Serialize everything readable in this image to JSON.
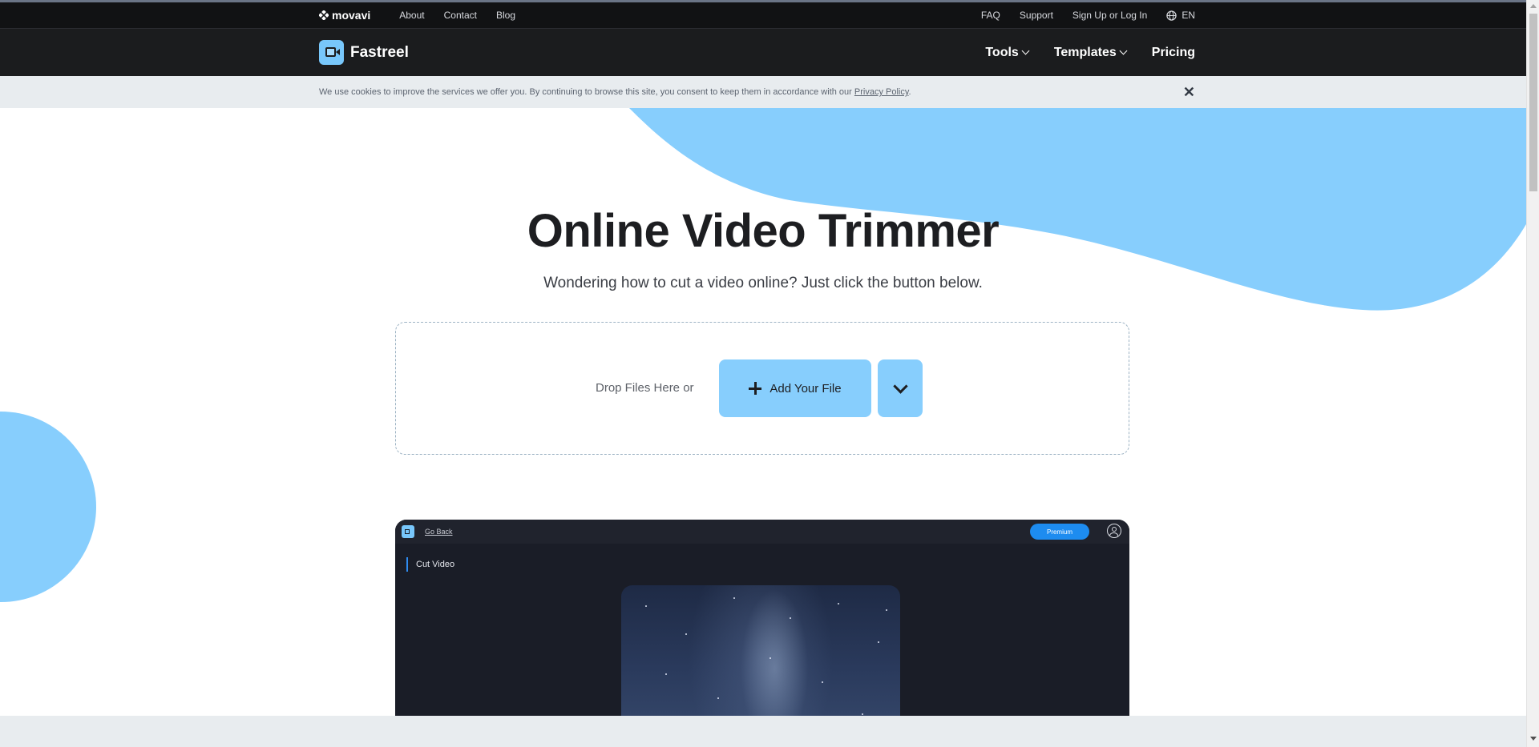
{
  "movavi_bar": {
    "logo_text": "movavi",
    "left_links": [
      "About",
      "Contact",
      "Blog"
    ],
    "right_links": [
      "FAQ",
      "Support",
      "Sign Up or Log In"
    ],
    "language": "EN"
  },
  "nav": {
    "brand": "Fastreel",
    "items": [
      {
        "label": "Tools",
        "dropdown": true
      },
      {
        "label": "Templates",
        "dropdown": true
      },
      {
        "label": "Pricing",
        "dropdown": false
      }
    ]
  },
  "cookie": {
    "text": "We use cookies to improve the services we offer you. By continuing to browse this site, you consent to keep them in accordance with our ",
    "link": "Privacy Policy",
    "tail": ".",
    "close": "✕"
  },
  "hero": {
    "title": "Online Video Trimmer",
    "subtitle": "Wondering how to cut a video online? Just click the button below."
  },
  "upload": {
    "drop_text": "Drop Files Here or",
    "add_button": "Add Your File"
  },
  "preview": {
    "back_link": "Go Back",
    "premium": "Premium",
    "section": "Cut Video"
  },
  "colors": {
    "accent": "#87cefd",
    "dark": "#1b1c1e",
    "premium": "#1d8cf0"
  }
}
